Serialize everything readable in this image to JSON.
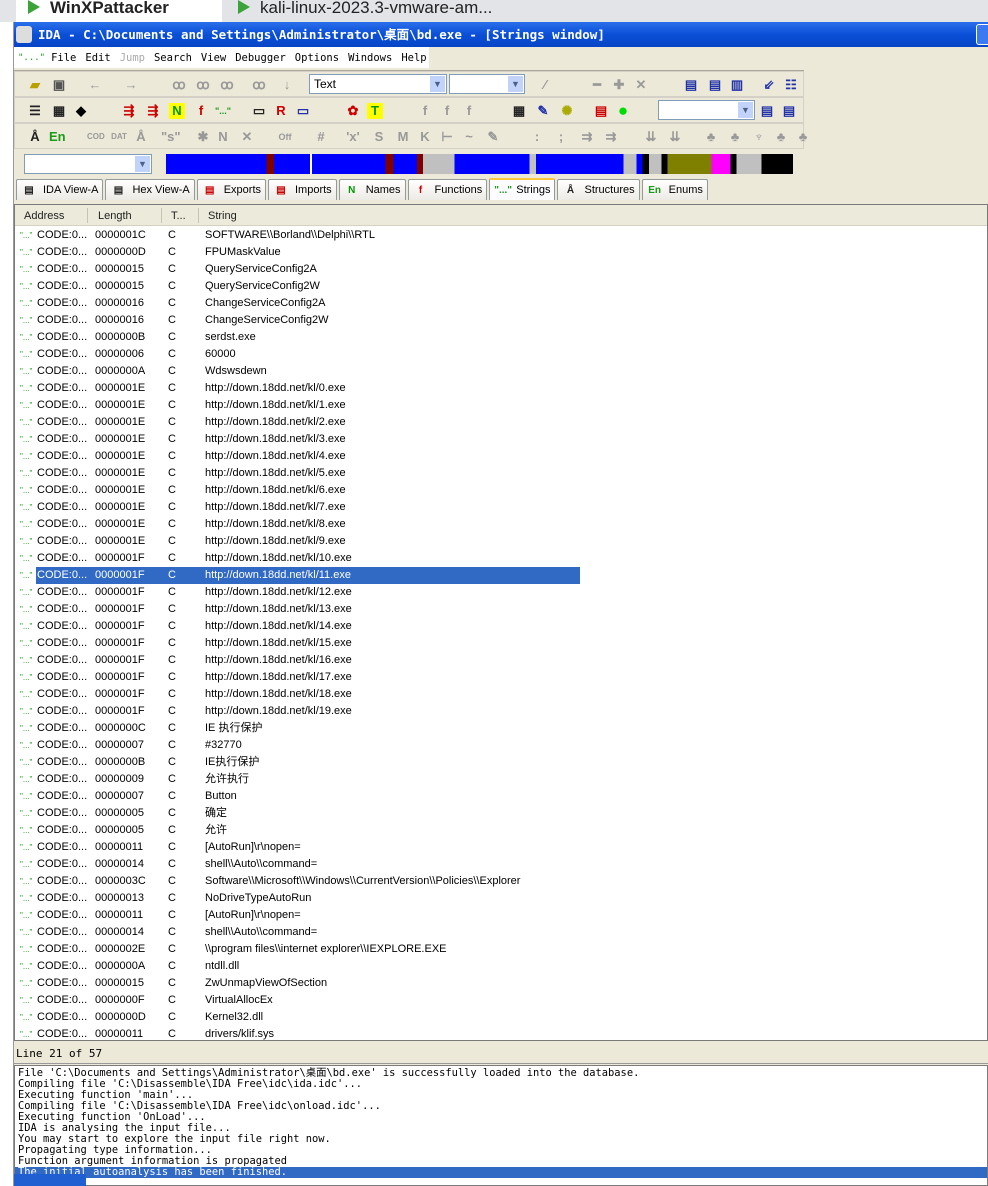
{
  "host_tabs": [
    {
      "label": "WinXPattacker"
    },
    {
      "label": "kali-linux-2023.3-vmware-am..."
    }
  ],
  "window": {
    "title": "IDA - C:\\Documents and Settings\\Administrator\\桌面\\bd.exe - [Strings window]"
  },
  "menu": {
    "items": [
      "File",
      "Edit",
      "Jump",
      "Search",
      "View",
      "Debugger",
      "Options",
      "Windows",
      "Help"
    ],
    "disabled": [
      "Jump"
    ]
  },
  "toolbar": {
    "search_type_combo": "Text"
  },
  "tabs": [
    {
      "label": "IDA View-A",
      "icon": "text-document-icon"
    },
    {
      "label": "Hex View-A",
      "icon": "hex-icon"
    },
    {
      "label": "Exports",
      "icon": "exports-icon"
    },
    {
      "label": "Imports",
      "icon": "imports-icon"
    },
    {
      "label": "Names",
      "icon": "names-icon",
      "glyph": "N"
    },
    {
      "label": "Functions",
      "icon": "function-icon",
      "glyph": "f"
    },
    {
      "label": "Strings",
      "icon": "strings-icon",
      "glyph": "\"...\"",
      "active": true
    },
    {
      "label": "Structures",
      "icon": "structures-icon",
      "glyph": "Å"
    },
    {
      "label": "Enums",
      "icon": "enums-icon",
      "glyph": "En"
    }
  ],
  "list": {
    "columns": [
      "Address",
      "Length",
      "T...",
      "String"
    ],
    "row_icon": "\"...\"",
    "selected_index": 20,
    "rows": [
      {
        "addr": "CODE:0...",
        "len": "0000001C",
        "type": "C",
        "str": "SOFTWARE\\\\Borland\\\\Delphi\\\\RTL"
      },
      {
        "addr": "CODE:0...",
        "len": "0000000D",
        "type": "C",
        "str": "FPUMaskValue"
      },
      {
        "addr": "CODE:0...",
        "len": "00000015",
        "type": "C",
        "str": "QueryServiceConfig2A"
      },
      {
        "addr": "CODE:0...",
        "len": "00000015",
        "type": "C",
        "str": "QueryServiceConfig2W"
      },
      {
        "addr": "CODE:0...",
        "len": "00000016",
        "type": "C",
        "str": "ChangeServiceConfig2A"
      },
      {
        "addr": "CODE:0...",
        "len": "00000016",
        "type": "C",
        "str": "ChangeServiceConfig2W"
      },
      {
        "addr": "CODE:0...",
        "len": "0000000B",
        "type": "C",
        "str": "serdst.exe"
      },
      {
        "addr": "CODE:0...",
        "len": "00000006",
        "type": "C",
        "str": "60000"
      },
      {
        "addr": "CODE:0...",
        "len": "0000000A",
        "type": "C",
        "str": "Wdswsdewn"
      },
      {
        "addr": "CODE:0...",
        "len": "0000001E",
        "type": "C",
        "str": "http://down.18dd.net/kl/0.exe"
      },
      {
        "addr": "CODE:0...",
        "len": "0000001E",
        "type": "C",
        "str": "http://down.18dd.net/kl/1.exe"
      },
      {
        "addr": "CODE:0...",
        "len": "0000001E",
        "type": "C",
        "str": "http://down.18dd.net/kl/2.exe"
      },
      {
        "addr": "CODE:0...",
        "len": "0000001E",
        "type": "C",
        "str": "http://down.18dd.net/kl/3.exe"
      },
      {
        "addr": "CODE:0...",
        "len": "0000001E",
        "type": "C",
        "str": "http://down.18dd.net/kl/4.exe"
      },
      {
        "addr": "CODE:0...",
        "len": "0000001E",
        "type": "C",
        "str": "http://down.18dd.net/kl/5.exe"
      },
      {
        "addr": "CODE:0...",
        "len": "0000001E",
        "type": "C",
        "str": "http://down.18dd.net/kl/6.exe"
      },
      {
        "addr": "CODE:0...",
        "len": "0000001E",
        "type": "C",
        "str": "http://down.18dd.net/kl/7.exe"
      },
      {
        "addr": "CODE:0...",
        "len": "0000001E",
        "type": "C",
        "str": "http://down.18dd.net/kl/8.exe"
      },
      {
        "addr": "CODE:0...",
        "len": "0000001E",
        "type": "C",
        "str": "http://down.18dd.net/kl/9.exe"
      },
      {
        "addr": "CODE:0...",
        "len": "0000001F",
        "type": "C",
        "str": "http://down.18dd.net/kl/10.exe"
      },
      {
        "addr": "CODE:0...",
        "len": "0000001F",
        "type": "C",
        "str": "http://down.18dd.net/kl/11.exe"
      },
      {
        "addr": "CODE:0...",
        "len": "0000001F",
        "type": "C",
        "str": "http://down.18dd.net/kl/12.exe"
      },
      {
        "addr": "CODE:0...",
        "len": "0000001F",
        "type": "C",
        "str": "http://down.18dd.net/kl/13.exe"
      },
      {
        "addr": "CODE:0...",
        "len": "0000001F",
        "type": "C",
        "str": "http://down.18dd.net/kl/14.exe"
      },
      {
        "addr": "CODE:0...",
        "len": "0000001F",
        "type": "C",
        "str": "http://down.18dd.net/kl/15.exe"
      },
      {
        "addr": "CODE:0...",
        "len": "0000001F",
        "type": "C",
        "str": "http://down.18dd.net/kl/16.exe"
      },
      {
        "addr": "CODE:0...",
        "len": "0000001F",
        "type": "C",
        "str": "http://down.18dd.net/kl/17.exe"
      },
      {
        "addr": "CODE:0...",
        "len": "0000001F",
        "type": "C",
        "str": "http://down.18dd.net/kl/18.exe"
      },
      {
        "addr": "CODE:0...",
        "len": "0000001F",
        "type": "C",
        "str": "http://down.18dd.net/kl/19.exe"
      },
      {
        "addr": "CODE:0...",
        "len": "0000000C",
        "type": "C",
        "str": "IE 执行保护"
      },
      {
        "addr": "CODE:0...",
        "len": "00000007",
        "type": "C",
        "str": "#32770"
      },
      {
        "addr": "CODE:0...",
        "len": "0000000B",
        "type": "C",
        "str": "IE执行保护"
      },
      {
        "addr": "CODE:0...",
        "len": "00000009",
        "type": "C",
        "str": "允许执行"
      },
      {
        "addr": "CODE:0...",
        "len": "00000007",
        "type": "C",
        "str": "Button"
      },
      {
        "addr": "CODE:0...",
        "len": "00000005",
        "type": "C",
        "str": "确定"
      },
      {
        "addr": "CODE:0...",
        "len": "00000005",
        "type": "C",
        "str": "允许"
      },
      {
        "addr": "CODE:0...",
        "len": "00000011",
        "type": "C",
        "str": "[AutoRun]\\r\\nopen="
      },
      {
        "addr": "CODE:0...",
        "len": "00000014",
        "type": "C",
        "str": "shell\\\\Auto\\\\command="
      },
      {
        "addr": "CODE:0...",
        "len": "0000003C",
        "type": "C",
        "str": "Software\\\\Microsoft\\\\Windows\\\\CurrentVersion\\\\Policies\\\\Explorer"
      },
      {
        "addr": "CODE:0...",
        "len": "00000013",
        "type": "C",
        "str": "NoDriveTypeAutoRun"
      },
      {
        "addr": "CODE:0...",
        "len": "00000011",
        "type": "C",
        "str": "[AutoRun]\\r\\nopen="
      },
      {
        "addr": "CODE:0...",
        "len": "00000014",
        "type": "C",
        "str": "shell\\\\Auto\\\\command="
      },
      {
        "addr": "CODE:0...",
        "len": "0000002E",
        "type": "C",
        "str": "\\\\program files\\\\internet explorer\\\\IEXPLORE.EXE"
      },
      {
        "addr": "CODE:0...",
        "len": "0000000A",
        "type": "C",
        "str": "ntdll.dll"
      },
      {
        "addr": "CODE:0...",
        "len": "00000015",
        "type": "C",
        "str": "ZwUnmapViewOfSection"
      },
      {
        "addr": "CODE:0...",
        "len": "0000000F",
        "type": "C",
        "str": "VirtualAllocEx"
      },
      {
        "addr": "CODE:0...",
        "len": "0000000D",
        "type": "C",
        "str": "Kernel32.dll"
      },
      {
        "addr": "CODE:0...",
        "len": "00000011",
        "type": "C",
        "str": "drivers/klif.sys"
      }
    ]
  },
  "status": {
    "text": "Line 21 of 57"
  },
  "output": {
    "lines": [
      "File 'C:\\Documents and Settings\\Administrator\\桌面\\bd.exe' is successfully loaded into the database.",
      "Compiling file 'C:\\Disassemble\\IDA Free\\idc\\ida.idc'...",
      "Executing function 'main'...",
      "Compiling file 'C:\\Disassemble\\IDA Free\\idc\\onload.idc'...",
      "Executing function 'OnLoad'...",
      "IDA is analysing the input file...",
      "You may start to explore the input file right now.",
      "Propagating type information...",
      "Function argument information is propagated",
      "The initial autoanalysis has been finished."
    ],
    "selected_index": 9
  },
  "colors": {
    "title_blue": "#0a4fd8",
    "selection": "#316ac5",
    "string_icon_green": "#1a9b1a"
  }
}
